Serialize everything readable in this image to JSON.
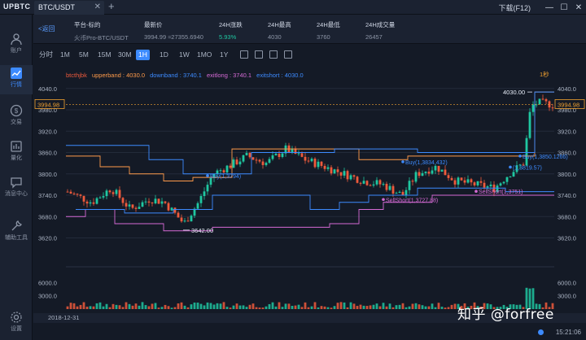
{
  "app": {
    "logo": "UPBTC",
    "tab_label": "BTC/USDT",
    "tab_close": "✕",
    "tab_add": "+",
    "download_label": "下载(F12)"
  },
  "window": {
    "minimize": "—",
    "maximize": "☐",
    "close": "✕"
  },
  "sidebar": {
    "items": [
      {
        "label": "账户",
        "icon": "user-icon"
      },
      {
        "label": "行情",
        "icon": "chart-icon",
        "active": true
      },
      {
        "label": "交易",
        "icon": "trade-icon"
      },
      {
        "label": "量化",
        "icon": "quant-icon"
      },
      {
        "label": "消息中心",
        "icon": "message-icon"
      },
      {
        "label": "辅助工具",
        "icon": "tools-icon"
      },
      {
        "label": "设置",
        "icon": "gear-icon"
      }
    ]
  },
  "ticker": {
    "back_label": "<返回",
    "pair_label": "平台-标的",
    "pair_value": "火币Pro-BTC/USDT",
    "last_label": "最新价",
    "last_value": "3994.99  ≈27355.6940",
    "change_label": "24H涨跌",
    "change_value": "5.93%",
    "high_label": "24H最高",
    "high_value": "4030",
    "low_label": "24H最低",
    "low_value": "3760",
    "volume_label": "24H成交量",
    "volume_value": "26457"
  },
  "toolbar": {
    "timeframes": [
      "分时",
      "1M",
      "5M",
      "15M",
      "30M",
      "1H",
      "1D",
      "1W",
      "1MO",
      "1Y"
    ],
    "active_timeframe": "1H"
  },
  "chart_data": {
    "type": "candlestick",
    "legend": {
      "name": "btcthjbk",
      "upperband": "upperband : 4030.0",
      "downband": "downband : 3740.1",
      "exitlong": "exitlong : 3740.1",
      "exitshort": "exitshort : 4030.0"
    },
    "ylim": [
      3580,
      4060
    ],
    "y_ticks": [
      4040.0,
      3980.0,
      3920.0,
      3860.0,
      3800.0,
      3740.0,
      3680.0,
      3620.0
    ],
    "volume_ticks": [
      6000.0,
      3000.0
    ],
    "last_price_label": "3994.98",
    "high_label": "4030.00",
    "low_label": "3642.00",
    "period_label": "1秒",
    "annotations": [
      {
        "text": "Buy(1,3794)",
        "x": 0.29,
        "y": 3795
      },
      {
        "text": "Buy(1,3834.432)",
        "x": 0.69,
        "y": 3834
      },
      {
        "text": "SellShort(1,3727.88)",
        "x": 0.65,
        "y": 3728
      },
      {
        "text": "SellShort(1,3751)",
        "x": 0.84,
        "y": 3751
      },
      {
        "text": "Buy(1,3850.1266)",
        "x": 0.93,
        "y": 3850
      },
      {
        "text": "(1,3819.57)",
        "x": 0.91,
        "y": 3819
      }
    ],
    "date_label": "2018-12-31",
    "colors": {
      "up": "#1fc7a1",
      "down": "#ee5a3c",
      "upper": "#ff9b4a",
      "down_band": "#3d8bff",
      "exitlong": "#d66bd6",
      "exitshort": "#3d8bff",
      "last": "#f0a030"
    }
  },
  "status": {
    "time": "15:21:06"
  },
  "watermark": "知乎 @forfree"
}
